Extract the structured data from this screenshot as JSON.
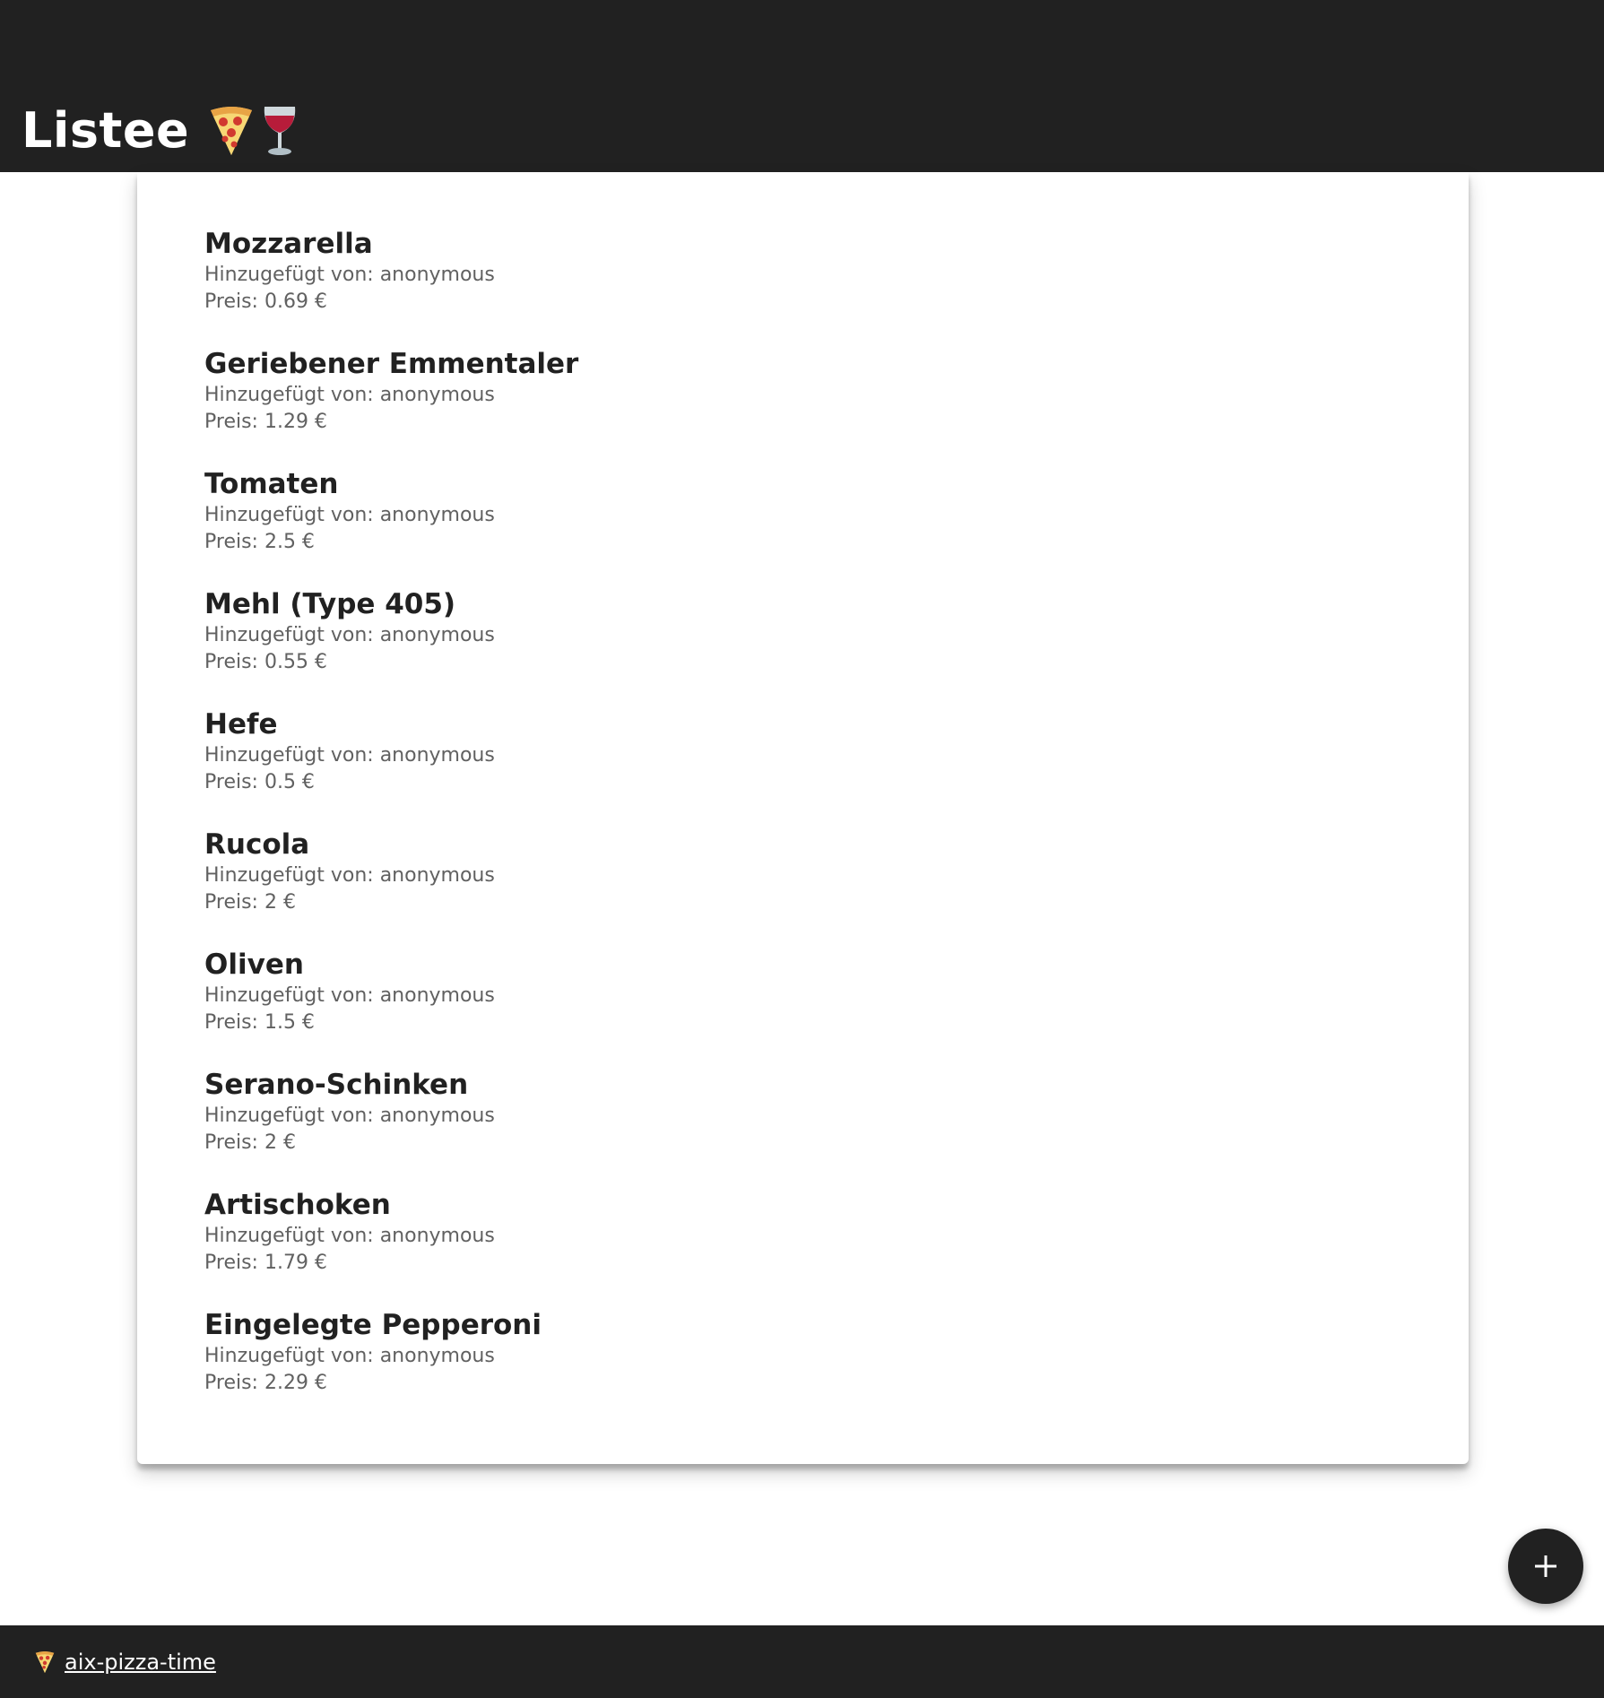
{
  "header": {
    "title": "Listee",
    "icons": [
      "pizza-icon",
      "wine-glass-icon"
    ],
    "background": "#212121"
  },
  "items": [
    {
      "name": "Mozzarella",
      "added_by": "Hinzugefügt von: anonymous",
      "price": "Preis: 0.69 €"
    },
    {
      "name": "Geriebener Emmentaler",
      "added_by": "Hinzugefügt von: anonymous",
      "price": "Preis: 1.29 €"
    },
    {
      "name": "Tomaten",
      "added_by": "Hinzugefügt von: anonymous",
      "price": "Preis: 2.5 €"
    },
    {
      "name": "Mehl (Type 405)",
      "added_by": "Hinzugefügt von: anonymous",
      "price": "Preis: 0.55 €"
    },
    {
      "name": "Hefe",
      "added_by": "Hinzugefügt von: anonymous",
      "price": "Preis: 0.5 €"
    },
    {
      "name": "Rucola",
      "added_by": "Hinzugefügt von: anonymous",
      "price": "Preis: 2 €"
    },
    {
      "name": "Oliven",
      "added_by": "Hinzugefügt von: anonymous",
      "price": "Preis: 1.5 €"
    },
    {
      "name": "Serano-Schinken",
      "added_by": "Hinzugefügt von: anonymous",
      "price": "Preis: 2 €"
    },
    {
      "name": "Artischoken",
      "added_by": "Hinzugefügt von: anonymous",
      "price": "Preis: 1.79 €"
    },
    {
      "name": "Eingelegte Pepperoni",
      "added_by": "Hinzugefügt von: anonymous",
      "price": "Preis: 2.29 €"
    }
  ],
  "fab": {
    "icon": "plus-icon"
  },
  "footer": {
    "icon": "pizza-icon",
    "link_text": "aix-pizza-time",
    "background": "#212121"
  }
}
